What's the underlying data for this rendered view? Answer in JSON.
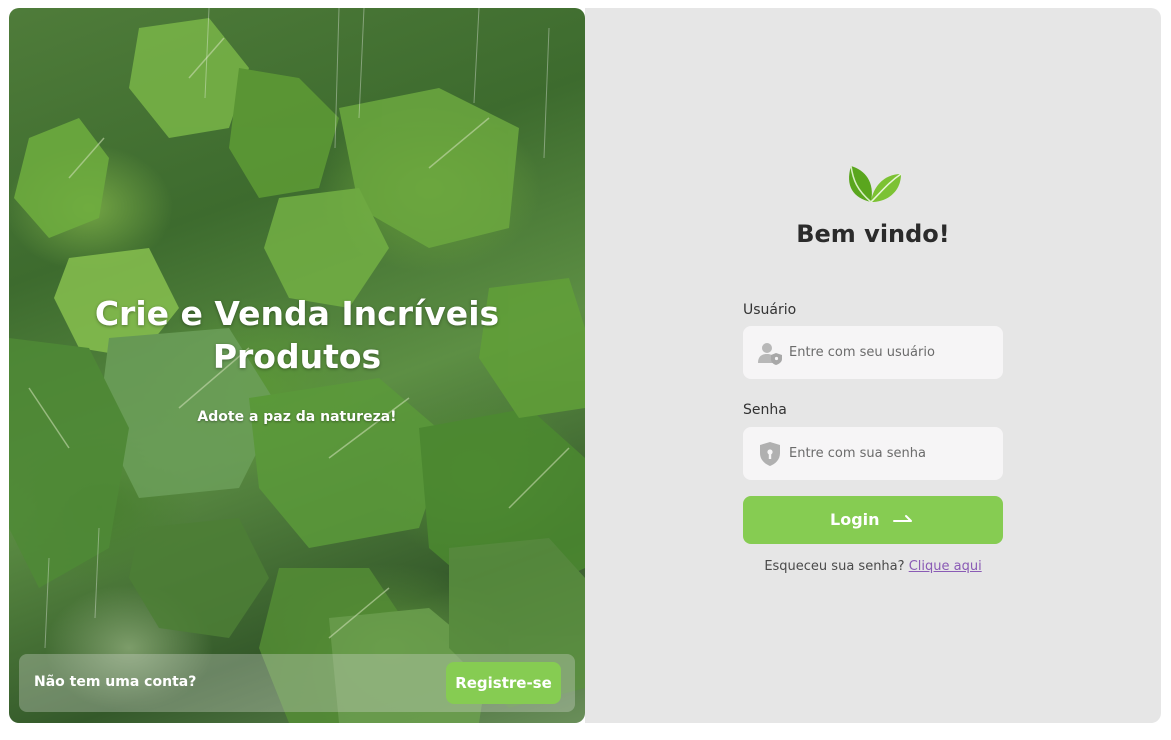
{
  "hero": {
    "title_line1": "Crie e Venda Incríveis",
    "title_line2": "Produtos",
    "subtitle": "Adote a paz da natureza!",
    "signup_prompt": "Não tem uma conta?",
    "signup_button": "Registre-se",
    "image_icon": "rain-leaves-photo"
  },
  "login": {
    "logo_icon": "leaf-logo-icon",
    "welcome": "Bem vindo!",
    "username": {
      "label": "Usuário",
      "placeholder": "Entre com seu usuário",
      "value": "",
      "icon": "user-shield-icon"
    },
    "password": {
      "label": "Senha",
      "placeholder": "Entre com sua senha",
      "value": "",
      "icon": "shield-lock-icon"
    },
    "button_label": "Login",
    "button_icon": "arrow-right-icon",
    "forgot_text": "Esqueceu sua senha?",
    "forgot_link": "Clique aqui"
  },
  "colors": {
    "accent_green": "#86cc52",
    "panel_bg": "#e6e6e6",
    "field_bg": "#f6f5f6",
    "link_purple": "#8a5bb5"
  }
}
